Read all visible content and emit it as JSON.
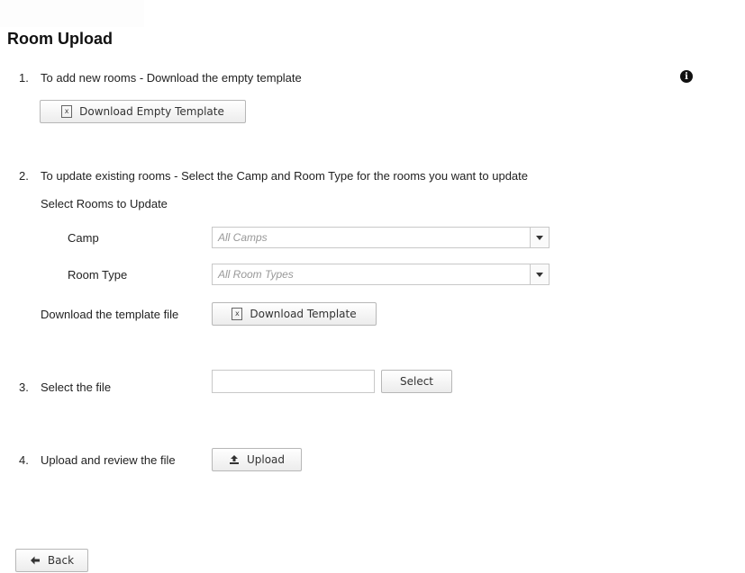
{
  "page": {
    "title": "Room Upload"
  },
  "step1": {
    "num": "1.",
    "text": "To add new rooms - Download the empty template",
    "button_label": "Download Empty Template"
  },
  "step2": {
    "num": "2.",
    "text": "To update existing rooms - Select the Camp and Room Type for the rooms you want to update",
    "subheading": "Select Rooms to Update",
    "camp_label": "Camp",
    "camp_value": "All Camps",
    "room_type_label": "Room Type",
    "room_type_value": "All Room Types",
    "download_label": "Download the template file",
    "download_button": "Download Template"
  },
  "step3": {
    "num": "3.",
    "text": "Select the file",
    "file_value": "",
    "select_button": "Select"
  },
  "step4": {
    "num": "4.",
    "text": "Upload and review the file",
    "upload_button": "Upload"
  },
  "footer": {
    "back_button": "Back"
  },
  "icons": {
    "info": "info-icon",
    "excel": "excel-file-icon",
    "upload": "upload-icon",
    "back": "arrow-left-icon",
    "dropdown": "chevron-down-icon"
  }
}
